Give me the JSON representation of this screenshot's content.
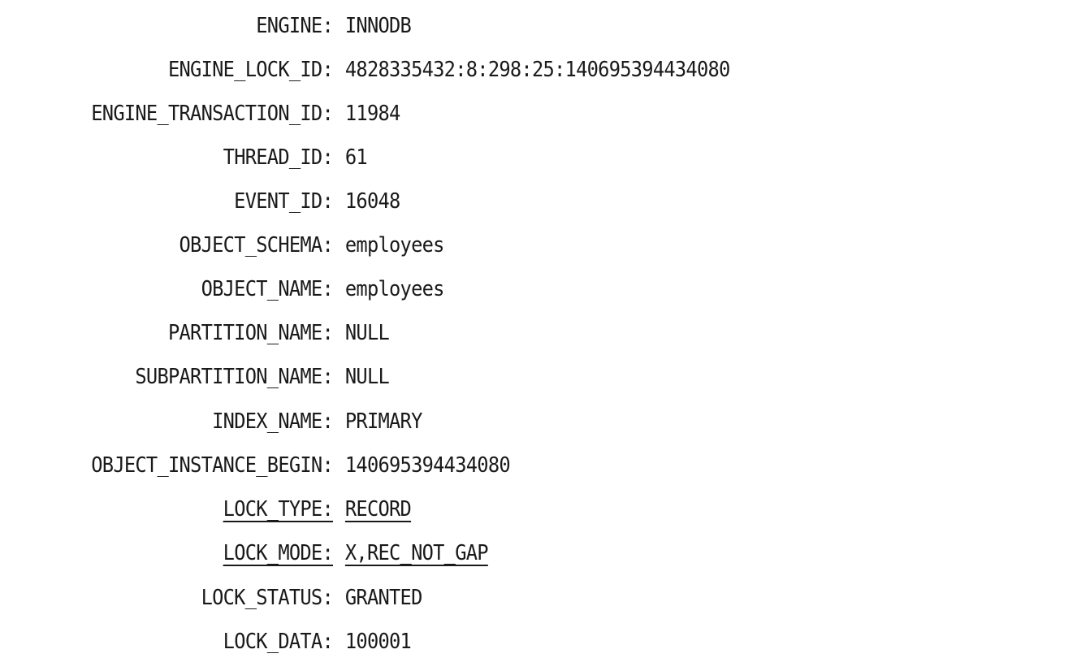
{
  "record": {
    "rows": [
      {
        "key": "ENGINE:",
        "value": "INNODB",
        "underlined": false
      },
      {
        "key": "ENGINE_LOCK_ID:",
        "value": "4828335432:8:298:25:140695394434080",
        "underlined": false
      },
      {
        "key": "ENGINE_TRANSACTION_ID:",
        "value": "11984",
        "underlined": false
      },
      {
        "key": "THREAD_ID:",
        "value": "61",
        "underlined": false
      },
      {
        "key": "EVENT_ID:",
        "value": "16048",
        "underlined": false
      },
      {
        "key": "OBJECT_SCHEMA:",
        "value": "employees",
        "underlined": false
      },
      {
        "key": "OBJECT_NAME:",
        "value": "employees",
        "underlined": false
      },
      {
        "key": "PARTITION_NAME:",
        "value": "NULL",
        "underlined": false
      },
      {
        "key": "SUBPARTITION_NAME:",
        "value": "NULL",
        "underlined": false
      },
      {
        "key": "INDEX_NAME:",
        "value": "PRIMARY",
        "underlined": false
      },
      {
        "key": "OBJECT_INSTANCE_BEGIN:",
        "value": "140695394434080",
        "underlined": false
      },
      {
        "key": "LOCK_TYPE:",
        "value": "RECORD",
        "underlined": true
      },
      {
        "key": "LOCK_MODE:",
        "value": "X,REC_NOT_GAP",
        "underlined": true
      },
      {
        "key": "LOCK_STATUS:",
        "value": "GRANTED",
        "underlined": false
      },
      {
        "key": "LOCK_DATA:",
        "value": "100001",
        "underlined": false
      }
    ]
  }
}
